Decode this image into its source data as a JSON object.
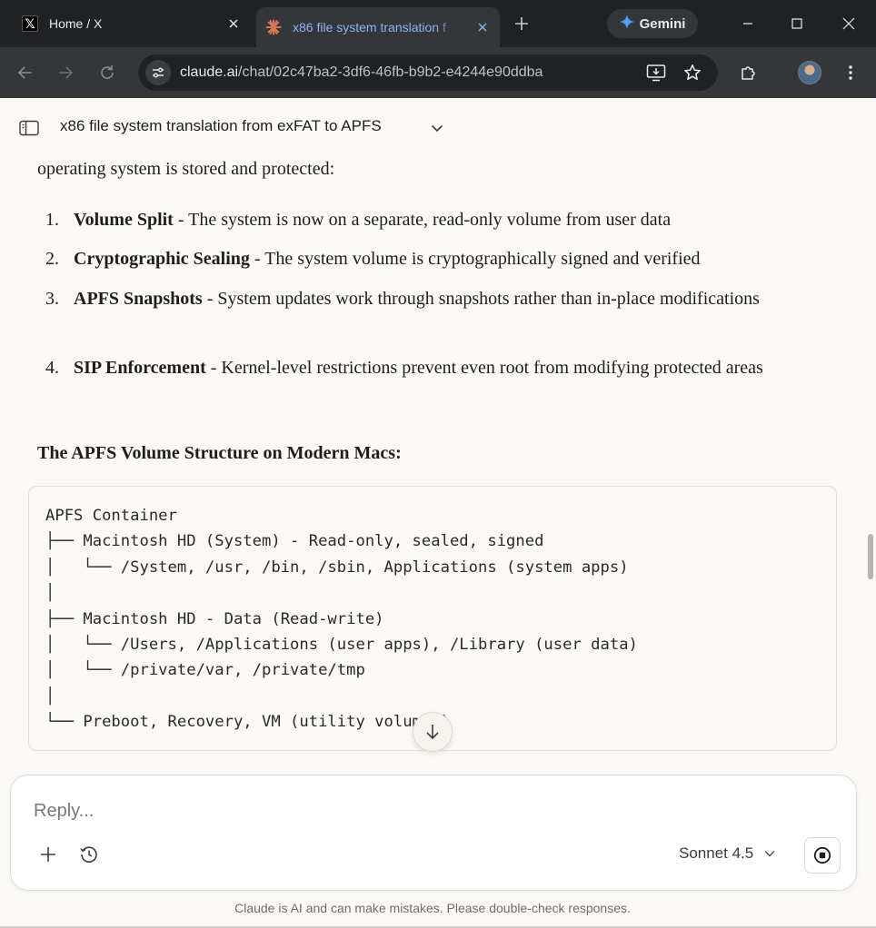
{
  "browser": {
    "tabs": [
      {
        "title": "Home / X",
        "favicon": "x-logo-icon",
        "active": false
      },
      {
        "title": "x86 file system translation f",
        "favicon": "claude-sunburst-icon",
        "active": true
      }
    ],
    "gemini_label": "Gemini",
    "url_host": "claude.ai",
    "url_path": "/chat/02c47ba2-3df6-46fb-b9b2-e4244e90ddba"
  },
  "chat": {
    "title": "x86 file system translation from exFAT to APFS",
    "intro": "operating system is stored and protected:",
    "list": [
      {
        "num": "1.",
        "term": "Volume Split",
        "text": " - The system is now on a separate, read-only volume from user data"
      },
      {
        "num": "2.",
        "term": "Cryptographic Sealing",
        "text": " - The system volume is cryptographically signed and verified"
      },
      {
        "num": "3.",
        "term": "APFS Snapshots",
        "text": " - System updates work through snapshots rather than in-place modifications"
      },
      {
        "num": "4.",
        "term": "SIP Enforcement",
        "text": " - Kernel-level restrictions prevent even root from modifying protected areas"
      }
    ],
    "section_heading": "The APFS Volume Structure on Modern Macs:",
    "code_lines": [
      "APFS Container",
      "├── Macintosh HD (System) - Read-only, sealed, signed",
      "│   └── /System, /usr, /bin, /sbin, Applications (system apps)",
      "│",
      "├── Macintosh HD - Data (Read-write)",
      "│   └── /Users, /Applications (user apps), /Library (user data)",
      "│   └── /private/var, /private/tmp",
      "│",
      "└── Preboot, Recovery, VM (utility volumes)"
    ]
  },
  "composer": {
    "placeholder": "Reply...",
    "model": "Sonnet 4.5"
  },
  "disclaimer": "Claude is AI and can make mistakes. Please double-check responses.",
  "colors": {
    "page_bg": "#faf9f5",
    "browser_dark": "#202124",
    "toolbar": "#35363a",
    "active_tab_text": "#8ab4f8",
    "claude_accent": "#d97757"
  }
}
